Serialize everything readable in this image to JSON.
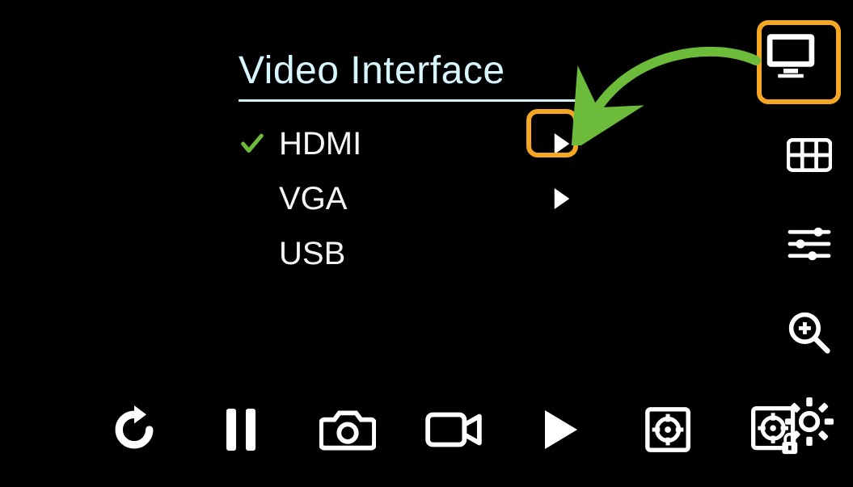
{
  "menu": {
    "title": "Video Interface",
    "items": [
      {
        "label": "HDMI",
        "selected": true,
        "has_submenu": true
      },
      {
        "label": "VGA",
        "selected": false,
        "has_submenu": true
      },
      {
        "label": "USB",
        "selected": false,
        "has_submenu": false
      }
    ]
  },
  "sidebar_icons": {
    "monitor": "monitor-icon",
    "grid": "grid-icon",
    "sliders": "adjust-icon",
    "zoom": "zoom-in-icon",
    "settings": "gear-icon"
  },
  "bottombar_icons": {
    "refresh": "rotate-icon",
    "pause": "pause-icon",
    "snapshot": "camera-icon",
    "record": "video-icon",
    "play": "play-icon",
    "crosshair": "crosshair-icon",
    "crosshair_l": "crosshair-lock-icon"
  },
  "colors": {
    "highlight": "#f5a623",
    "arrow": "#6dbb3b",
    "check": "#6dbb3b",
    "title": "#d7f7ff"
  }
}
